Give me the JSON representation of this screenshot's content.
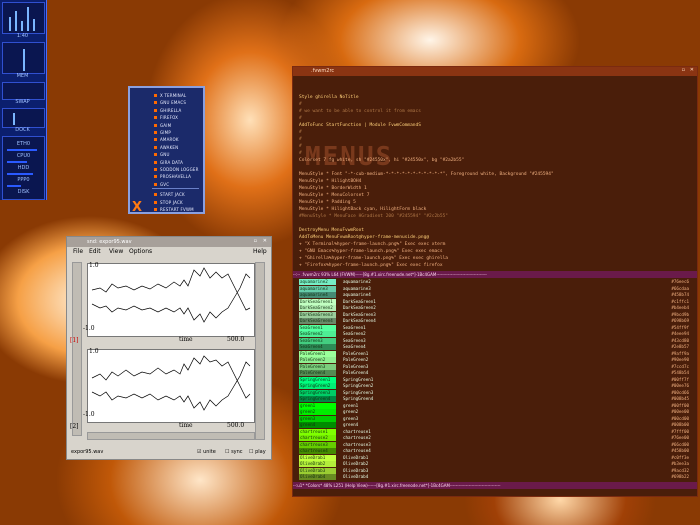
{
  "dock": {
    "labels": [
      "1:40",
      "MEM",
      "SWAP",
      "DOCK",
      "ETH0",
      "PPP0"
    ],
    "rows": [
      "ETH0",
      "CPU0",
      "HDD",
      "PPP0",
      "DISK"
    ]
  },
  "menu": {
    "items": [
      "X TERMINAL",
      "GNU EMACS",
      "GHIRELLA",
      "FIREFOX",
      "GAIM",
      "GIMP",
      "AMAROK",
      "AWAKEN",
      "GNU",
      "GIRA DATA",
      "SODDON LOGGER",
      "PROSHAVELLA",
      "GVC",
      "START JACK",
      "STOP JACK",
      "RESTART FVWM"
    ],
    "logo": "X"
  },
  "sound": {
    "title": "snd: expor95.wav",
    "menus": [
      "File",
      "Edit",
      "View",
      "Options",
      "Help"
    ],
    "y_top": "1.0",
    "y_bottom": "-1.0",
    "x_label": "time",
    "x_end": "500.0",
    "channel_labels": [
      "[1]",
      "[2]"
    ],
    "status_file": "expor95.wav",
    "checks": [
      "unite",
      "sync",
      "play"
    ]
  },
  "emacs": {
    "title": ".fvwm2rc",
    "lines": [
      {
        "text": "Style ghirella NoTitle",
        "cls": "ekey"
      },
      {
        "text": "#",
        "cls": "ecomment"
      },
      {
        "text": "# we want to be able to control it from emacs",
        "cls": "ecomment"
      },
      {
        "text": "#",
        "cls": "ecomment"
      },
      {
        "text": "AddToFunc StartFunction | Module FvwmCommandS",
        "cls": "ekey"
      },
      {
        "text": "#",
        "cls": "ecomment"
      },
      {
        "text": "#",
        "cls": "ecomment"
      },
      {
        "text": "#",
        "cls": "ecomment"
      },
      {
        "text": "#",
        "cls": "ecomment"
      },
      {
        "text": "Colorset 7 fg white, sh \"#24550x\", hi \"#24550x\", bg \"#2a2b55\"",
        "cls": ""
      },
      {
        "text": "",
        "cls": ""
      },
      {
        "text": "MenuStyle * Font \"-*-cub-medium-*-*-*-*-*-*-*-*-*-*-*\", Foreground white, Background \"#245594\"",
        "cls": ""
      },
      {
        "text": "MenuStyle * HilightBOH4",
        "cls": ""
      },
      {
        "text": "MenuStyle * BorderWidth 1",
        "cls": ""
      },
      {
        "text": "MenuStyle * MenuColorset 7",
        "cls": ""
      },
      {
        "text": "MenuStyle * Padding 5",
        "cls": ""
      },
      {
        "text": "MenuStyle * HilightBack cyan, HilightForm black",
        "cls": ""
      },
      {
        "text": "#MenuStyle * MenuFace HGradient 200 \"#245594\" \"#2c2b55\"",
        "cls": "ecomment"
      },
      {
        "text": "",
        "cls": ""
      },
      {
        "text": "DestroyMenu MenuFvwmRoot",
        "cls": "ekey"
      },
      {
        "text": "AddToMenu MenuFvwmRoot@hyper-frame-menuside.png@",
        "cls": "ekey"
      },
      {
        "text": " + \"X Terminal%hyper-frame-launch.png%\"     Exec exec xterm",
        "cls": ""
      },
      {
        "text": " + \"GNU Emacs%hyper-frame-launch.png%\"      Exec exec emacs",
        "cls": ""
      },
      {
        "text": " + \"Ghirella%hyper-frame-launch.png%\"       Exec exec ghirella",
        "cls": ""
      },
      {
        "text": " + \"Firefox%hyper-frame-launch.png%\"        Exec exec firefox",
        "cls": ""
      }
    ],
    "modeline_top": "--:--  .fvwm2rc                    93% L64     (FVWM)-----[8g.#1.xirc.freenode.net*]-1Bc4GAM-----------------------------------",
    "modeline_bottom": "--:u1*  *Colors*                48% L251     (Help View)------[8g.#1.xirc.freenode.net*]-1Bc4GAM-----------------------------------",
    "colors": [
      {
        "a": "aquamarine2",
        "b": "aquamarine2",
        "hex": "#76eec6",
        "sw": "#76eec6"
      },
      {
        "a": "aquamarine3",
        "b": "aquamarine3",
        "hex": "#66cdaa",
        "sw": "#66cdaa"
      },
      {
        "a": "aquamarine4",
        "b": "aquamarine4",
        "hex": "#458b74",
        "sw": "#458b74"
      },
      {
        "a": "DarkSeaGreen1",
        "b": "DarkSeaGreen1",
        "hex": "#c1ffc1",
        "sw": "#c1ffc1"
      },
      {
        "a": "DarkSeaGreen2",
        "b": "DarkSeaGreen2",
        "hex": "#b4eeb4",
        "sw": "#b4eeb4"
      },
      {
        "a": "DarkSeaGreen3",
        "b": "DarkSeaGreen3",
        "hex": "#9bcd9b",
        "sw": "#9bcd9b"
      },
      {
        "a": "DarkSeaGreen4",
        "b": "DarkSeaGreen4",
        "hex": "#698b69",
        "sw": "#698b69"
      },
      {
        "a": "SeaGreen1",
        "b": "SeaGreen1",
        "hex": "#54ff9f",
        "sw": "#54ff9f"
      },
      {
        "a": "SeaGreen2",
        "b": "SeaGreen2",
        "hex": "#4eee94",
        "sw": "#4eee94"
      },
      {
        "a": "SeaGreen3",
        "b": "SeaGreen3",
        "hex": "#43cd80",
        "sw": "#43cd80"
      },
      {
        "a": "SeaGreen4",
        "b": "SeaGreen4",
        "hex": "#2e8b57",
        "sw": "#2e8b57"
      },
      {
        "a": "PaleGreen1",
        "b": "PaleGreen1",
        "hex": "#9aff9a",
        "sw": "#9aff9a"
      },
      {
        "a": "PaleGreen2",
        "b": "PaleGreen2",
        "hex": "#90ee90",
        "sw": "#90ee90"
      },
      {
        "a": "PaleGreen3",
        "b": "PaleGreen3",
        "hex": "#7ccd7c",
        "sw": "#7ccd7c"
      },
      {
        "a": "PaleGreen4",
        "b": "PaleGreen4",
        "hex": "#548b54",
        "sw": "#548b54"
      },
      {
        "a": "SpringGreen1",
        "b": "SpringGreen1",
        "hex": "#00ff7f",
        "sw": "#00ff7f"
      },
      {
        "a": "SpringGreen2",
        "b": "SpringGreen2",
        "hex": "#00ee76",
        "sw": "#00ee76"
      },
      {
        "a": "SpringGreen3",
        "b": "SpringGreen3",
        "hex": "#00cd66",
        "sw": "#00cd66"
      },
      {
        "a": "SpringGreen4",
        "b": "SpringGreen4",
        "hex": "#008b45",
        "sw": "#008b45"
      },
      {
        "a": "green1",
        "b": "green1",
        "hex": "#00ff00",
        "sw": "#00ff00"
      },
      {
        "a": "green2",
        "b": "green2",
        "hex": "#00ee00",
        "sw": "#00ee00"
      },
      {
        "a": "green3",
        "b": "green3",
        "hex": "#00cd00",
        "sw": "#00cd00"
      },
      {
        "a": "green4",
        "b": "green4",
        "hex": "#008b00",
        "sw": "#008b00"
      },
      {
        "a": "chartreuse1",
        "b": "chartreuse1",
        "hex": "#7fff00",
        "sw": "#7fff00"
      },
      {
        "a": "chartreuse2",
        "b": "chartreuse2",
        "hex": "#76ee00",
        "sw": "#76ee00"
      },
      {
        "a": "chartreuse3",
        "b": "chartreuse3",
        "hex": "#66cd00",
        "sw": "#66cd00"
      },
      {
        "a": "chartreuse4",
        "b": "chartreuse4",
        "hex": "#458b00",
        "sw": "#458b00"
      },
      {
        "a": "OliveDrab1",
        "b": "OliveDrab1",
        "hex": "#c0ff3e",
        "sw": "#c0ff3e"
      },
      {
        "a": "OliveDrab2",
        "b": "OliveDrab2",
        "hex": "#b3ee3a",
        "sw": "#b3ee3a"
      },
      {
        "a": "OliveDrab3",
        "b": "OliveDrab3",
        "hex": "#9acd32",
        "sw": "#9acd32"
      },
      {
        "a": "OliveDrab4",
        "b": "OliveDrab4",
        "hex": "#698b22",
        "sw": "#698b22"
      }
    ]
  }
}
